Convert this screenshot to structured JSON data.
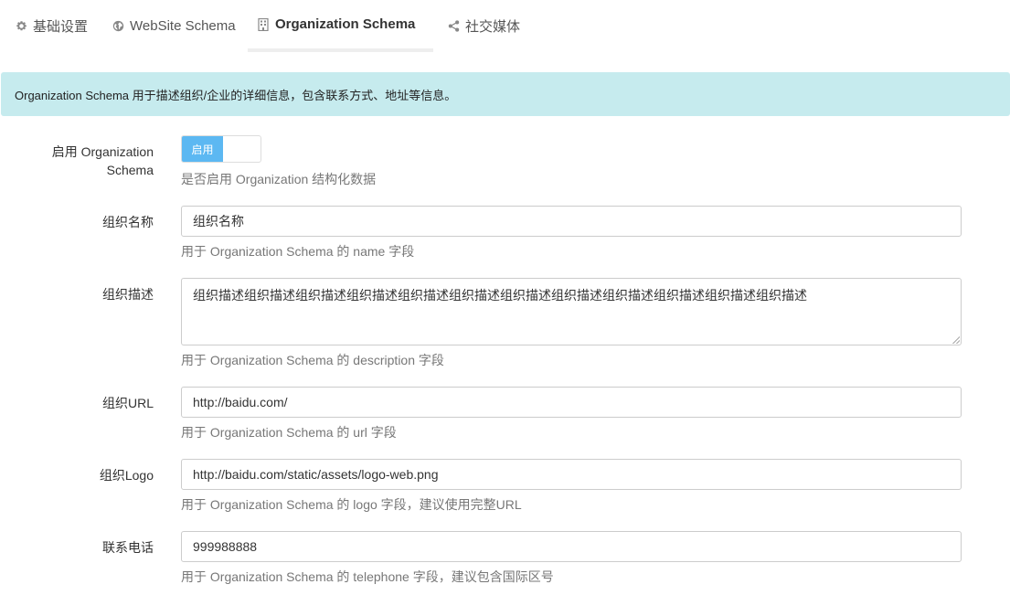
{
  "tabs": [
    {
      "label": "基础设置",
      "icon": "gear-icon"
    },
    {
      "label": "WebSite Schema",
      "icon": "globe-icon"
    },
    {
      "label": "Organization Schema",
      "icon": "building-icon"
    },
    {
      "label": "社交媒体",
      "icon": "share-icon"
    }
  ],
  "active_tab": "Organization Schema",
  "notice": "Organization Schema 用于描述组织/企业的详细信息，包含联系方式、地址等信息。",
  "form": {
    "enable": {
      "label_line1": "启用 Organization",
      "label_line2": "Schema",
      "toggle_on_label": "启用",
      "help": "是否启用 Organization 结构化数据"
    },
    "name": {
      "label": "组织名称",
      "value": "组织名称",
      "help": "用于 Organization Schema 的 name 字段"
    },
    "description": {
      "label": "组织描述",
      "value": "组织描述组织描述组织描述组织描述组织描述组织描述组织描述组织描述组织描述组织描述组织描述组织描述",
      "help": "用于 Organization Schema 的 description 字段"
    },
    "url": {
      "label": "组织URL",
      "value": "http://baidu.com/",
      "help": "用于 Organization Schema 的 url 字段"
    },
    "logo": {
      "label": "组织Logo",
      "value": "http://baidu.com/static/assets/logo-web.png",
      "help": "用于 Organization Schema 的 logo 字段，建议使用完整URL"
    },
    "telephone": {
      "label": "联系电话",
      "value": "999988888",
      "help": "用于 Organization Schema 的 telephone 字段，建议包含国际区号"
    }
  },
  "colors": {
    "notice_bg": "#c6ebee",
    "toggle_on": "#5cb8f2"
  }
}
